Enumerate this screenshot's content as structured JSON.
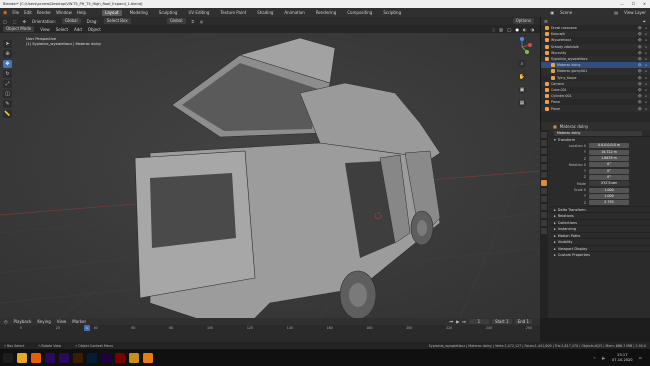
{
  "window": {
    "title": "Blender* [C:\\Users\\pcnew\\Desktop\\VW-T5_PH_T5_High_Roof_Expand_1.blend]",
    "controls": [
      "—",
      "☐",
      "✕"
    ]
  },
  "menubar": {
    "menus": [
      "File",
      "Edit",
      "Render",
      "Window",
      "Help"
    ],
    "workspaces": [
      "Layout",
      "Modeling",
      "Sculpting",
      "UV Editing",
      "Texture Paint",
      "Shading",
      "Animation",
      "Rendering",
      "Compositing",
      "Scripting"
    ],
    "active_workspace": "Layout",
    "scene": "Scene",
    "view_layer": "View Layer"
  },
  "header": {
    "orientation_label": "Orientation:",
    "orientation_value": "Global",
    "drag_label": "Drag:",
    "drag_value": "Select Box",
    "transform_global": "Global",
    "options": "Options"
  },
  "viewport_header": {
    "mode": "Object Mode",
    "menus": [
      "View",
      "Select",
      "Add",
      "Object"
    ]
  },
  "viewport": {
    "info_line1": "User Perspective",
    "info_line2": "(1) Sypialnia_wyswietlacz | Materac dolny"
  },
  "outliner": {
    "items": [
      {
        "label": "Drzwi rozsuwne",
        "selected": false
      },
      {
        "label": "Korpusik",
        "selected": false
      },
      {
        "label": "Wyswietlacz",
        "selected": false
      },
      {
        "label": "Schody zdalniale",
        "selected": false
      },
      {
        "label": "Wyrzutky",
        "selected": false
      },
      {
        "label": "Sypialnia_wyswietlacz",
        "selected": false
      },
      {
        "label": "Materac dolny",
        "selected": true
      },
      {
        "label": "Materac gorny001",
        "selected": false
      },
      {
        "label": "Tylny_Korpe",
        "selected": false
      },
      {
        "label": "Camera",
        "selected": false
      },
      {
        "label": "Cube.001",
        "selected": false
      },
      {
        "label": "Cylinder.001",
        "selected": false
      },
      {
        "label": "Plane",
        "selected": false
      },
      {
        "label": "Plane",
        "selected": false
      }
    ]
  },
  "properties": {
    "object_name": "Materac dolny",
    "object_name_field": "Materac dolny",
    "transform_title": "Transform",
    "location_label": "Location X",
    "location": [
      "0.0.0.0.0.0 m",
      "16.722 m",
      "1.8678 m"
    ],
    "rotation_label": "Rotation X",
    "rotation": [
      "0°",
      "0°",
      "0°"
    ],
    "mode_label": "Mode",
    "mode_value": "XYZ Euler",
    "scale_label": "Scale X",
    "scale": [
      "1.000",
      "1.000",
      "2.795"
    ],
    "sections": [
      "Delta Transform",
      "Relations",
      "Collections",
      "Instancing",
      "Motion Paths",
      "Visibility",
      "Viewport Display",
      "Custom Properties"
    ]
  },
  "timeline": {
    "menus": [
      "Playback",
      "Keying",
      "View",
      "Marker"
    ],
    "current_frame": "1",
    "start_label": "Start",
    "start": "1",
    "end_label": "End",
    "end": "1",
    "ticks": [
      "0",
      "20",
      "40",
      "60",
      "80",
      "100",
      "120",
      "140",
      "160",
      "180",
      "200",
      "220",
      "240",
      "250"
    ]
  },
  "statusbar": {
    "select": "Box Select",
    "rotate": "Rotate View",
    "context_menu": "Object Context Menu",
    "stats": "Sypialnia_wyswietlacz | Materac dolny | Verts:1,472,127 | Faces:1,441,009 | Tris:2,817,470 | Objects:0/25 | Mem: 666.7 MiB | 2.90.0"
  },
  "taskbar": {
    "apps": [
      {
        "name": "windows-start",
        "color": "#1d1d1d"
      },
      {
        "name": "file-explorer",
        "color": "#e5a823"
      },
      {
        "name": "firefox",
        "color": "#e66000"
      },
      {
        "name": "premiere",
        "color": "#2a0a5e"
      },
      {
        "name": "after-effects",
        "color": "#2a0a5e"
      },
      {
        "name": "illustrator",
        "color": "#3a1c00"
      },
      {
        "name": "photoshop",
        "color": "#001e36"
      },
      {
        "name": "media-encoder",
        "color": "#1f0040"
      },
      {
        "name": "acrobat",
        "color": "#7a0000"
      },
      {
        "name": "folder",
        "color": "#c98f1a"
      },
      {
        "name": "blender",
        "color": "#e87d0d"
      }
    ],
    "time": "23:17",
    "date": "07.10.2020"
  }
}
